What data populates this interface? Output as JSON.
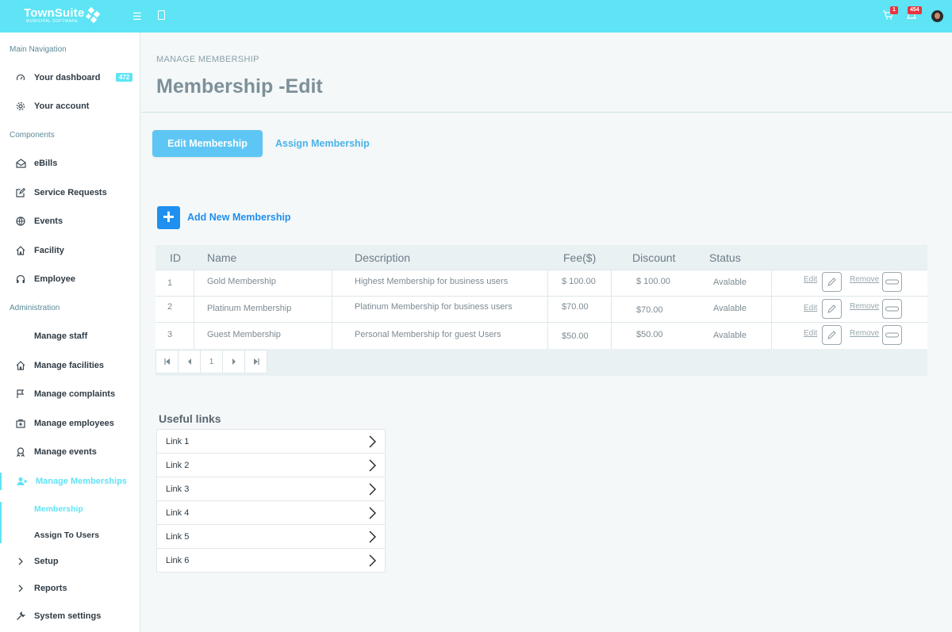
{
  "header": {
    "brand": "TownSuite",
    "brand_sub": "MUNICIPAL SOFTWARE",
    "cart_badge": "1",
    "notif_badge": "454"
  },
  "sidebar": {
    "main_nav_title": "Main Navigation",
    "dashboard": "Your dashboard",
    "dashboard_count": "472",
    "account": "Your account",
    "components_title": "Components",
    "ebills": "eBills",
    "service_requests": "Service Requests",
    "events": "Events",
    "facility": "Facility",
    "employee": "Employee",
    "admin_title": "Administration",
    "manage_staff": "Manage staff",
    "manage_facilities": "Manage facilities",
    "manage_complaints": "Manage complaints",
    "manage_employees": "Manage employees",
    "manage_events": "Manage events",
    "manage_memberships": "Manage Memberships",
    "sub_membership": "Membership",
    "sub_assign": "Assign To Users",
    "setup": "Setup",
    "reports": "Reports",
    "system_settings": "System settings"
  },
  "page": {
    "breadcrumb": "MANAGE MEMBERSHIP",
    "title": "Membership -Edit",
    "tab_edit": "Edit Membership",
    "tab_assign": "Assign Membership",
    "add_new": "Add New  Membership"
  },
  "table": {
    "headers": {
      "id": "ID",
      "name": "Name",
      "description": "Description",
      "fee": "Fee($)",
      "discount": "Discount",
      "status": "Status"
    },
    "rows": [
      {
        "id": "1",
        "name": "Gold Membership",
        "description": "Highest Membership for business users",
        "fee": "$ 100.00",
        "discount": "$ 100.00",
        "status": "Avalable",
        "edit": "Edit",
        "remove": "Remove"
      },
      {
        "id": "2",
        "name": "Platinum Membership",
        "description": "Platinum Membership  for business users",
        "fee": "$70.00",
        "discount": "$70.00",
        "status": "Avalable",
        "edit": "Edit",
        "remove": "Remove"
      },
      {
        "id": "3",
        "name": "Guest Membership",
        "description": "Personal Membership  for  guest  Users",
        "fee": "$50.00",
        "discount": "$50.00",
        "status": "Avalable",
        "edit": "Edit",
        "remove": "Remove"
      }
    ],
    "pager_page": "1"
  },
  "useful_links": {
    "title": "Useful links",
    "items": [
      "Link 1",
      "Link 2",
      "Link 3",
      "Link 4",
      "Link 5",
      "Link 6"
    ]
  },
  "colors": {
    "accent": "#5ee4f4",
    "primary_button": "#5ec6f4",
    "add_blue": "#1f8ff0",
    "badge_red": "#e8343f"
  }
}
